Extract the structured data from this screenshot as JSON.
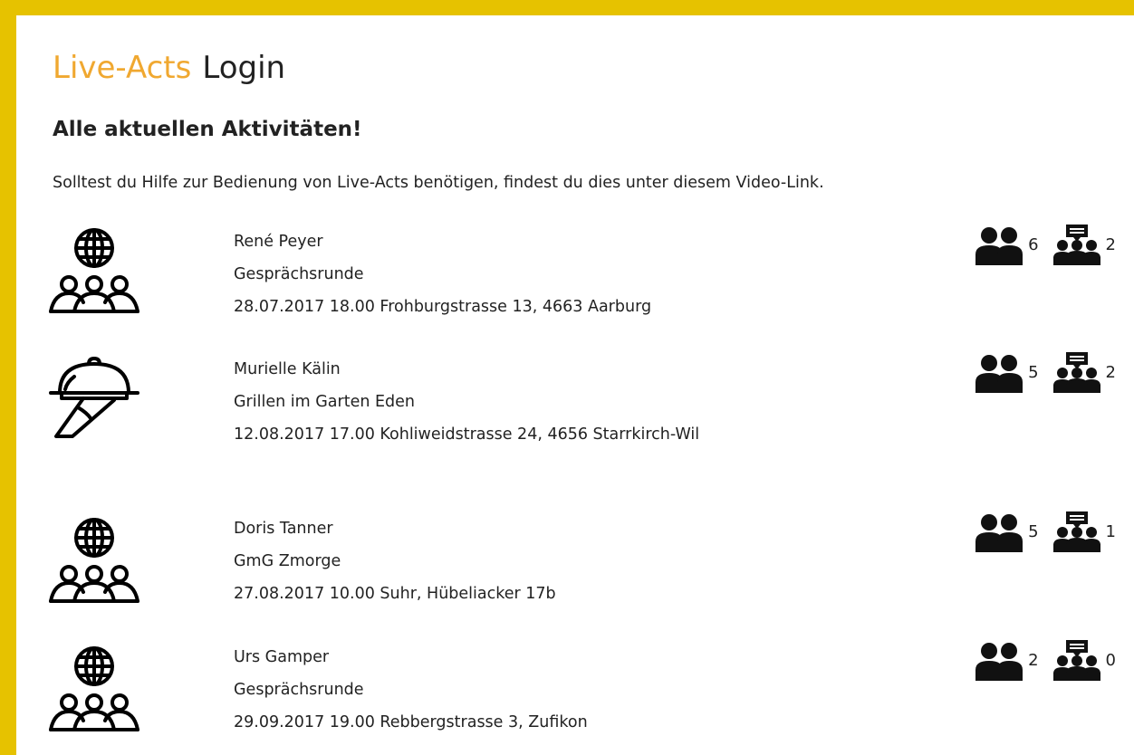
{
  "header": {
    "brand": "Live-Acts",
    "login": "Login"
  },
  "title": "Alle aktuellen Aktivitäten!",
  "help": {
    "prefix": "Solltest du Hilfe zur Bedienung von Live-Acts benötigen, findest du dies unter diesem ",
    "link": "Video-Link",
    "suffix": "."
  },
  "colors": {
    "frame": "#e6c200",
    "brand": "#f0a830",
    "text": "#222222"
  },
  "activities": [
    {
      "icon": "globe-group-icon",
      "name": "René Peyer",
      "event": "Gesprächsrunde",
      "when_where": "28.07.2017 18.00 Frohburgstrasse 13, 4663 Aarburg",
      "participants": "6",
      "comments": "2"
    },
    {
      "icon": "serving-cloche-icon",
      "name": "Murielle Kälin",
      "event": "Grillen im Garten Eden",
      "when_where": "12.08.2017 17.00 Kohliweidstrasse 24, 4656 Starrkirch-Wil",
      "participants": "5",
      "comments": "2"
    },
    {
      "icon": "globe-group-icon",
      "name": "Doris Tanner",
      "event": "GmG Zmorge",
      "when_where": "27.08.2017 10.00 Suhr, Hübeliacker 17b",
      "participants": "5",
      "comments": "1"
    },
    {
      "icon": "globe-group-icon",
      "name": "Urs Gamper",
      "event": "Gesprächsrunde",
      "when_where": "29.09.2017 19.00 Rebbergstrasse 3, Zufikon",
      "participants": "2",
      "comments": "0"
    }
  ]
}
